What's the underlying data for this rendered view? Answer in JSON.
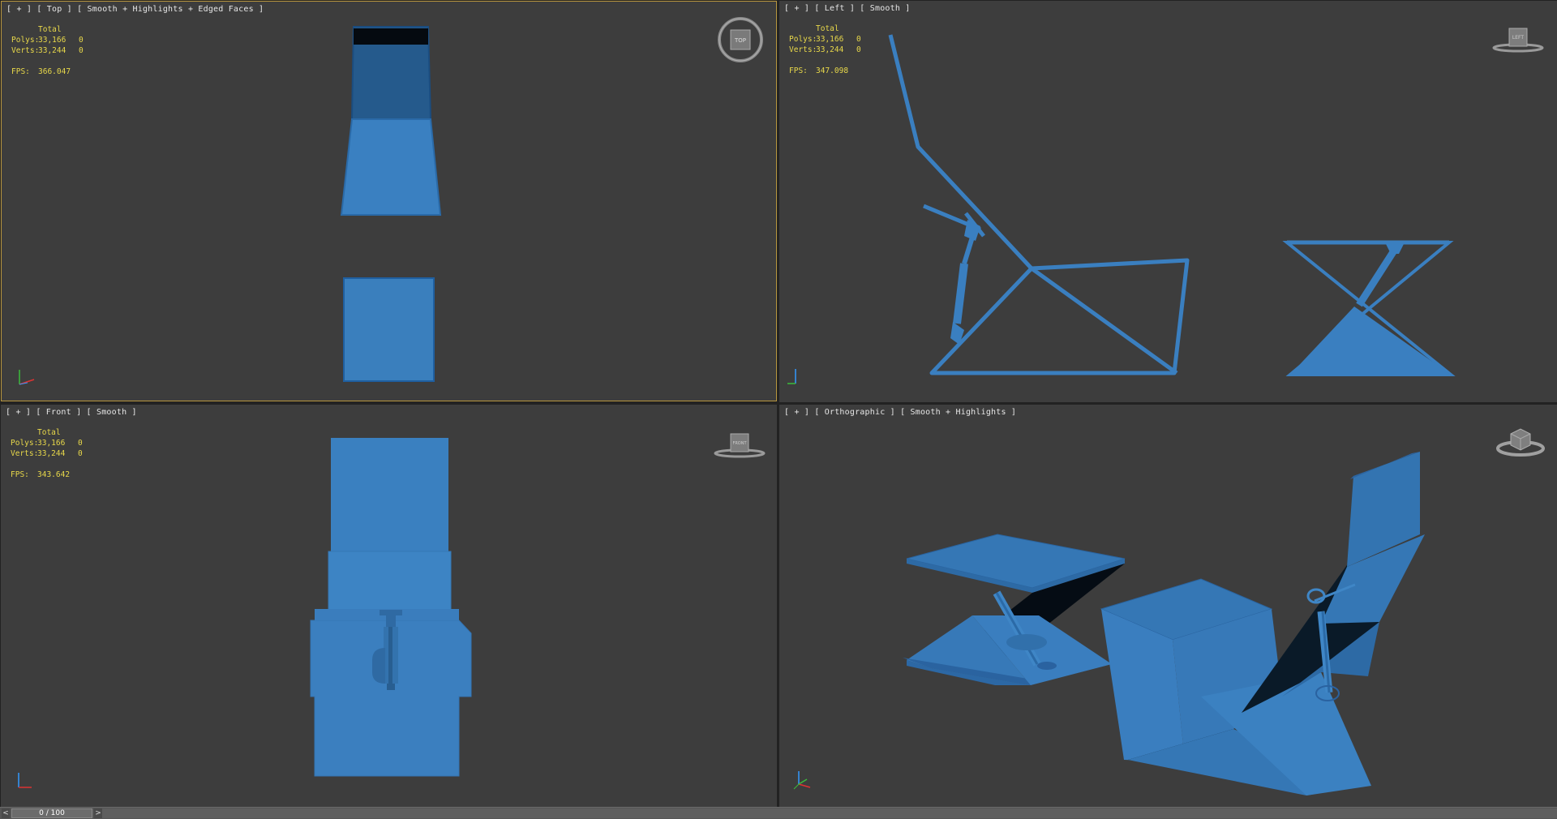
{
  "viewports": {
    "top": {
      "label": "[ + ] [ Top ] [ Smooth + Highlights + Edged Faces ]",
      "stats": {
        "header": "Total",
        "polys_label": "Polys:",
        "polys": "33,166",
        "polys_sel": "0",
        "verts_label": "Verts:",
        "verts": "33,244",
        "verts_sel": "0",
        "fps_label": "FPS:",
        "fps": "366.047"
      },
      "cube_label": "TOP"
    },
    "left": {
      "label": "[ + ] [ Left ] [ Smooth ]",
      "stats": {
        "header": "Total",
        "polys_label": "Polys:",
        "polys": "33,166",
        "polys_sel": "0",
        "verts_label": "Verts:",
        "verts": "33,244",
        "verts_sel": "0",
        "fps_label": "FPS:",
        "fps": "347.098"
      },
      "cube_label": "LEFT"
    },
    "front": {
      "label": "[ + ] [ Front ] [ Smooth ]",
      "stats": {
        "header": "Total",
        "polys_label": "Polys:",
        "polys": "33,166",
        "polys_sel": "0",
        "verts_label": "Verts:",
        "verts": "33,244",
        "verts_sel": "0",
        "fps_label": "FPS:",
        "fps": "343.642"
      },
      "cube_label": "FRONT"
    },
    "perspective": {
      "label": "[ + ] [ Orthographic ] [ Smooth + Highlights ]"
    }
  },
  "timeline": {
    "prev_label": "<",
    "next_label": ">",
    "frame_text": "0 / 100"
  },
  "colors": {
    "model_blue": "#3a7fc0",
    "model_dark": "#245a8a",
    "viewport_bg": "#3d3d3d",
    "stats_yellow": "#e8d84a",
    "active_border": "#b8963e"
  }
}
